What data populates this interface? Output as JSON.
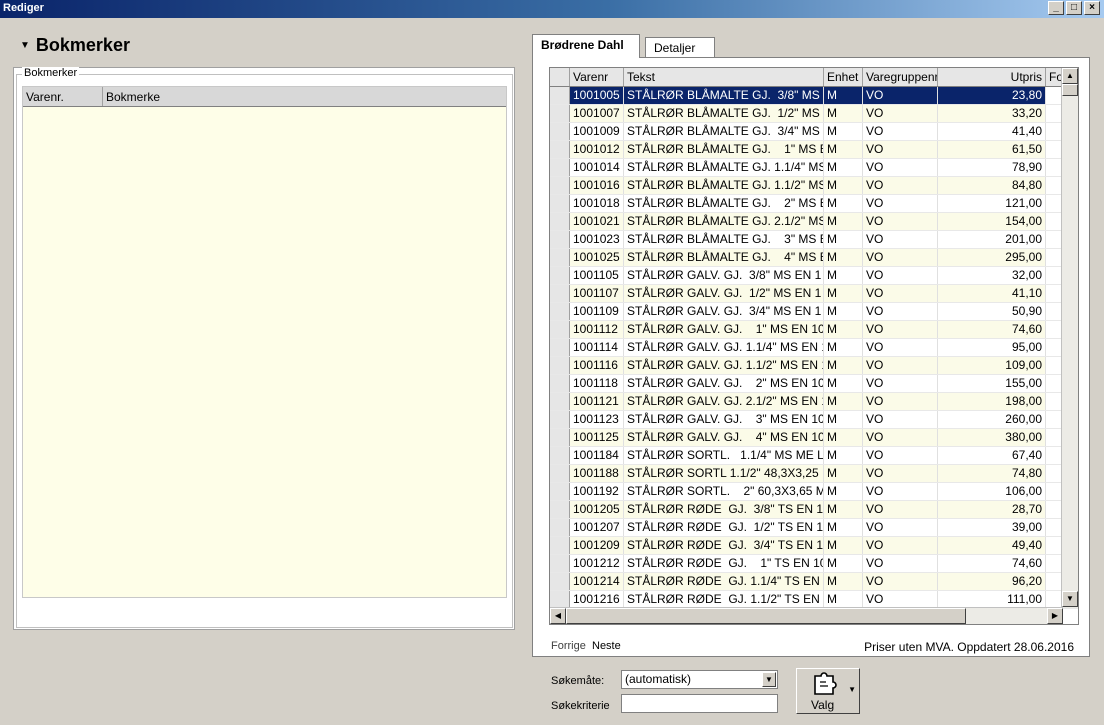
{
  "window": {
    "title": "Rediger"
  },
  "window_buttons": {
    "minimize": "_",
    "maximize": "□",
    "close": "×"
  },
  "section": {
    "title": "Bokmerker"
  },
  "bookmarks": {
    "group_label": "Bokmerker",
    "columns": [
      "Varenr.",
      "Bokmerke"
    ]
  },
  "tabs": [
    {
      "label": "Brødrene Dahl",
      "active": true
    },
    {
      "label": "Detaljer",
      "active": false
    }
  ],
  "grid": {
    "columns": [
      "Varenr",
      "Tekst",
      "Enhet",
      "Varegruppenr",
      "Utpris",
      "Fo"
    ],
    "rows": [
      [
        "1001005",
        "STÅLRØR BLÅMALTE GJ.  3/8\" MS",
        "M",
        "VO",
        "23,80"
      ],
      [
        "1001007",
        "STÅLRØR BLÅMALTE GJ.  1/2\" MS",
        "M",
        "VO",
        "33,20"
      ],
      [
        "1001009",
        "STÅLRØR BLÅMALTE GJ.  3/4\" MS",
        "M",
        "VO",
        "41,40"
      ],
      [
        "1001012",
        "STÅLRØR BLÅMALTE GJ.    1\" MS E",
        "M",
        "VO",
        "61,50"
      ],
      [
        "1001014",
        "STÅLRØR BLÅMALTE GJ. 1.1/4\" MS",
        "M",
        "VO",
        "78,90"
      ],
      [
        "1001016",
        "STÅLRØR BLÅMALTE GJ. 1.1/2\" MS",
        "M",
        "VO",
        "84,80"
      ],
      [
        "1001018",
        "STÅLRØR BLÅMALTE GJ.    2\" MS E",
        "M",
        "VO",
        "121,00"
      ],
      [
        "1001021",
        "STÅLRØR BLÅMALTE GJ. 2.1/2\" MS",
        "M",
        "VO",
        "154,00"
      ],
      [
        "1001023",
        "STÅLRØR BLÅMALTE GJ.    3\" MS E",
        "M",
        "VO",
        "201,00"
      ],
      [
        "1001025",
        "STÅLRØR BLÅMALTE GJ.    4\" MS E",
        "M",
        "VO",
        "295,00"
      ],
      [
        "1001105",
        "STÅLRØR GALV. GJ.  3/8\" MS EN 1",
        "M",
        "VO",
        "32,00"
      ],
      [
        "1001107",
        "STÅLRØR GALV. GJ.  1/2\" MS EN 1",
        "M",
        "VO",
        "41,10"
      ],
      [
        "1001109",
        "STÅLRØR GALV. GJ.  3/4\" MS EN 1",
        "M",
        "VO",
        "50,90"
      ],
      [
        "1001112",
        "STÅLRØR GALV. GJ.    1\" MS EN 10",
        "M",
        "VO",
        "74,60"
      ],
      [
        "1001114",
        "STÅLRØR GALV. GJ. 1.1/4\" MS EN 1",
        "M",
        "VO",
        "95,00"
      ],
      [
        "1001116",
        "STÅLRØR GALV. GJ. 1.1/2\" MS EN 1",
        "M",
        "VO",
        "109,00"
      ],
      [
        "1001118",
        "STÅLRØR GALV. GJ.    2\" MS EN 10",
        "M",
        "VO",
        "155,00"
      ],
      [
        "1001121",
        "STÅLRØR GALV. GJ. 2.1/2\" MS EN 1",
        "M",
        "VO",
        "198,00"
      ],
      [
        "1001123",
        "STÅLRØR GALV. GJ.    3\" MS EN 10",
        "M",
        "VO",
        "260,00"
      ],
      [
        "1001125",
        "STÅLRØR GALV. GJ.    4\" MS EN 10",
        "M",
        "VO",
        "380,00"
      ],
      [
        "1001184",
        "STÅLRØR SORTL.   1.1/4\" MS ME L",
        "M",
        "VO",
        "67,40"
      ],
      [
        "1001188",
        "STÅLRØR SORTL 1.1/2\" 48,3X3,25",
        "M",
        "VO",
        "74,80"
      ],
      [
        "1001192",
        "STÅLRØR SORTL.    2\" 60,3X3,65 M",
        "M",
        "VO",
        "106,00"
      ],
      [
        "1001205",
        "STÅLRØR RØDE  GJ.  3/8\" TS EN 1",
        "M",
        "VO",
        "28,70"
      ],
      [
        "1001207",
        "STÅLRØR RØDE  GJ.  1/2\" TS EN 1",
        "M",
        "VO",
        "39,00"
      ],
      [
        "1001209",
        "STÅLRØR RØDE  GJ.  3/4\" TS EN 1",
        "M",
        "VO",
        "49,40"
      ],
      [
        "1001212",
        "STÅLRØR RØDE  GJ.    1\" TS EN 10",
        "M",
        "VO",
        "74,60"
      ],
      [
        "1001214",
        "STÅLRØR RØDE  GJ. 1.1/4\" TS EN 1",
        "M",
        "VO",
        "96,20"
      ],
      [
        "1001216",
        "STÅLRØR RØDE  GJ. 1.1/2\" TS EN 1",
        "M",
        "VO",
        "111,00"
      ]
    ],
    "selected_index": 0
  },
  "pager": {
    "prev": "Forrige",
    "next": "Neste"
  },
  "status": "Priser uten MVA. Oppdatert 28.06.2016",
  "search": {
    "mode_label": "Søkemåte:",
    "mode_value": "(automatisk)",
    "criteria_label": "Søkekriterie",
    "criteria_value": ""
  },
  "valg_button": {
    "label": "Valg",
    "icon": "puzzle-icon"
  },
  "colors": {
    "selection": "#0a246a",
    "row_alt": "#fbfbe8",
    "panel_bg": "#fefee8"
  }
}
